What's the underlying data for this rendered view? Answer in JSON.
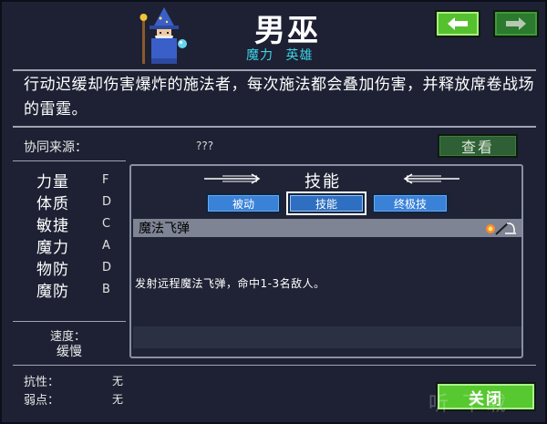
{
  "header": {
    "title": "男巫",
    "tags": [
      "魔力",
      "英雄"
    ],
    "prev_icon": "arrow-left-icon",
    "next_icon": "arrow-right-icon"
  },
  "description": "行动迟缓却伤害爆炸的施法者，每次施法都会叠加伤害，并释放席卷战场的雷霆。",
  "synergy": {
    "label": "协同来源：",
    "value": "???",
    "button": "查看"
  },
  "stats": [
    {
      "name": "力量",
      "grade": "F"
    },
    {
      "name": "体质",
      "grade": "D"
    },
    {
      "name": "敏捷",
      "grade": "C"
    },
    {
      "name": "魔力",
      "grade": "A"
    },
    {
      "name": "物防",
      "grade": "D"
    },
    {
      "name": "魔防",
      "grade": "B"
    }
  ],
  "speed": {
    "label": "速度：",
    "value": "缓慢"
  },
  "resistances": [
    {
      "label": "抗性：",
      "value": "无"
    },
    {
      "label": "弱点：",
      "value": "无"
    }
  ],
  "skills_panel": {
    "title": "技能",
    "tabs": [
      {
        "label": "被动",
        "active": false
      },
      {
        "label": "技能",
        "active": true
      },
      {
        "label": "终极技",
        "active": false
      }
    ],
    "selected_skill": {
      "name": "魔法飞弹",
      "icons": [
        "fire-orb-icon",
        "wand-icon"
      ],
      "description": "发射远程魔法飞弹，命中1-3名敌人。"
    }
  },
  "close_button": "关闭",
  "watermark": "听 下载",
  "colors": {
    "background": "#1d2133",
    "accent_green": "#57c830",
    "tag_cyan": "#3fd1e6",
    "tab_blue": "#3a82d8"
  }
}
